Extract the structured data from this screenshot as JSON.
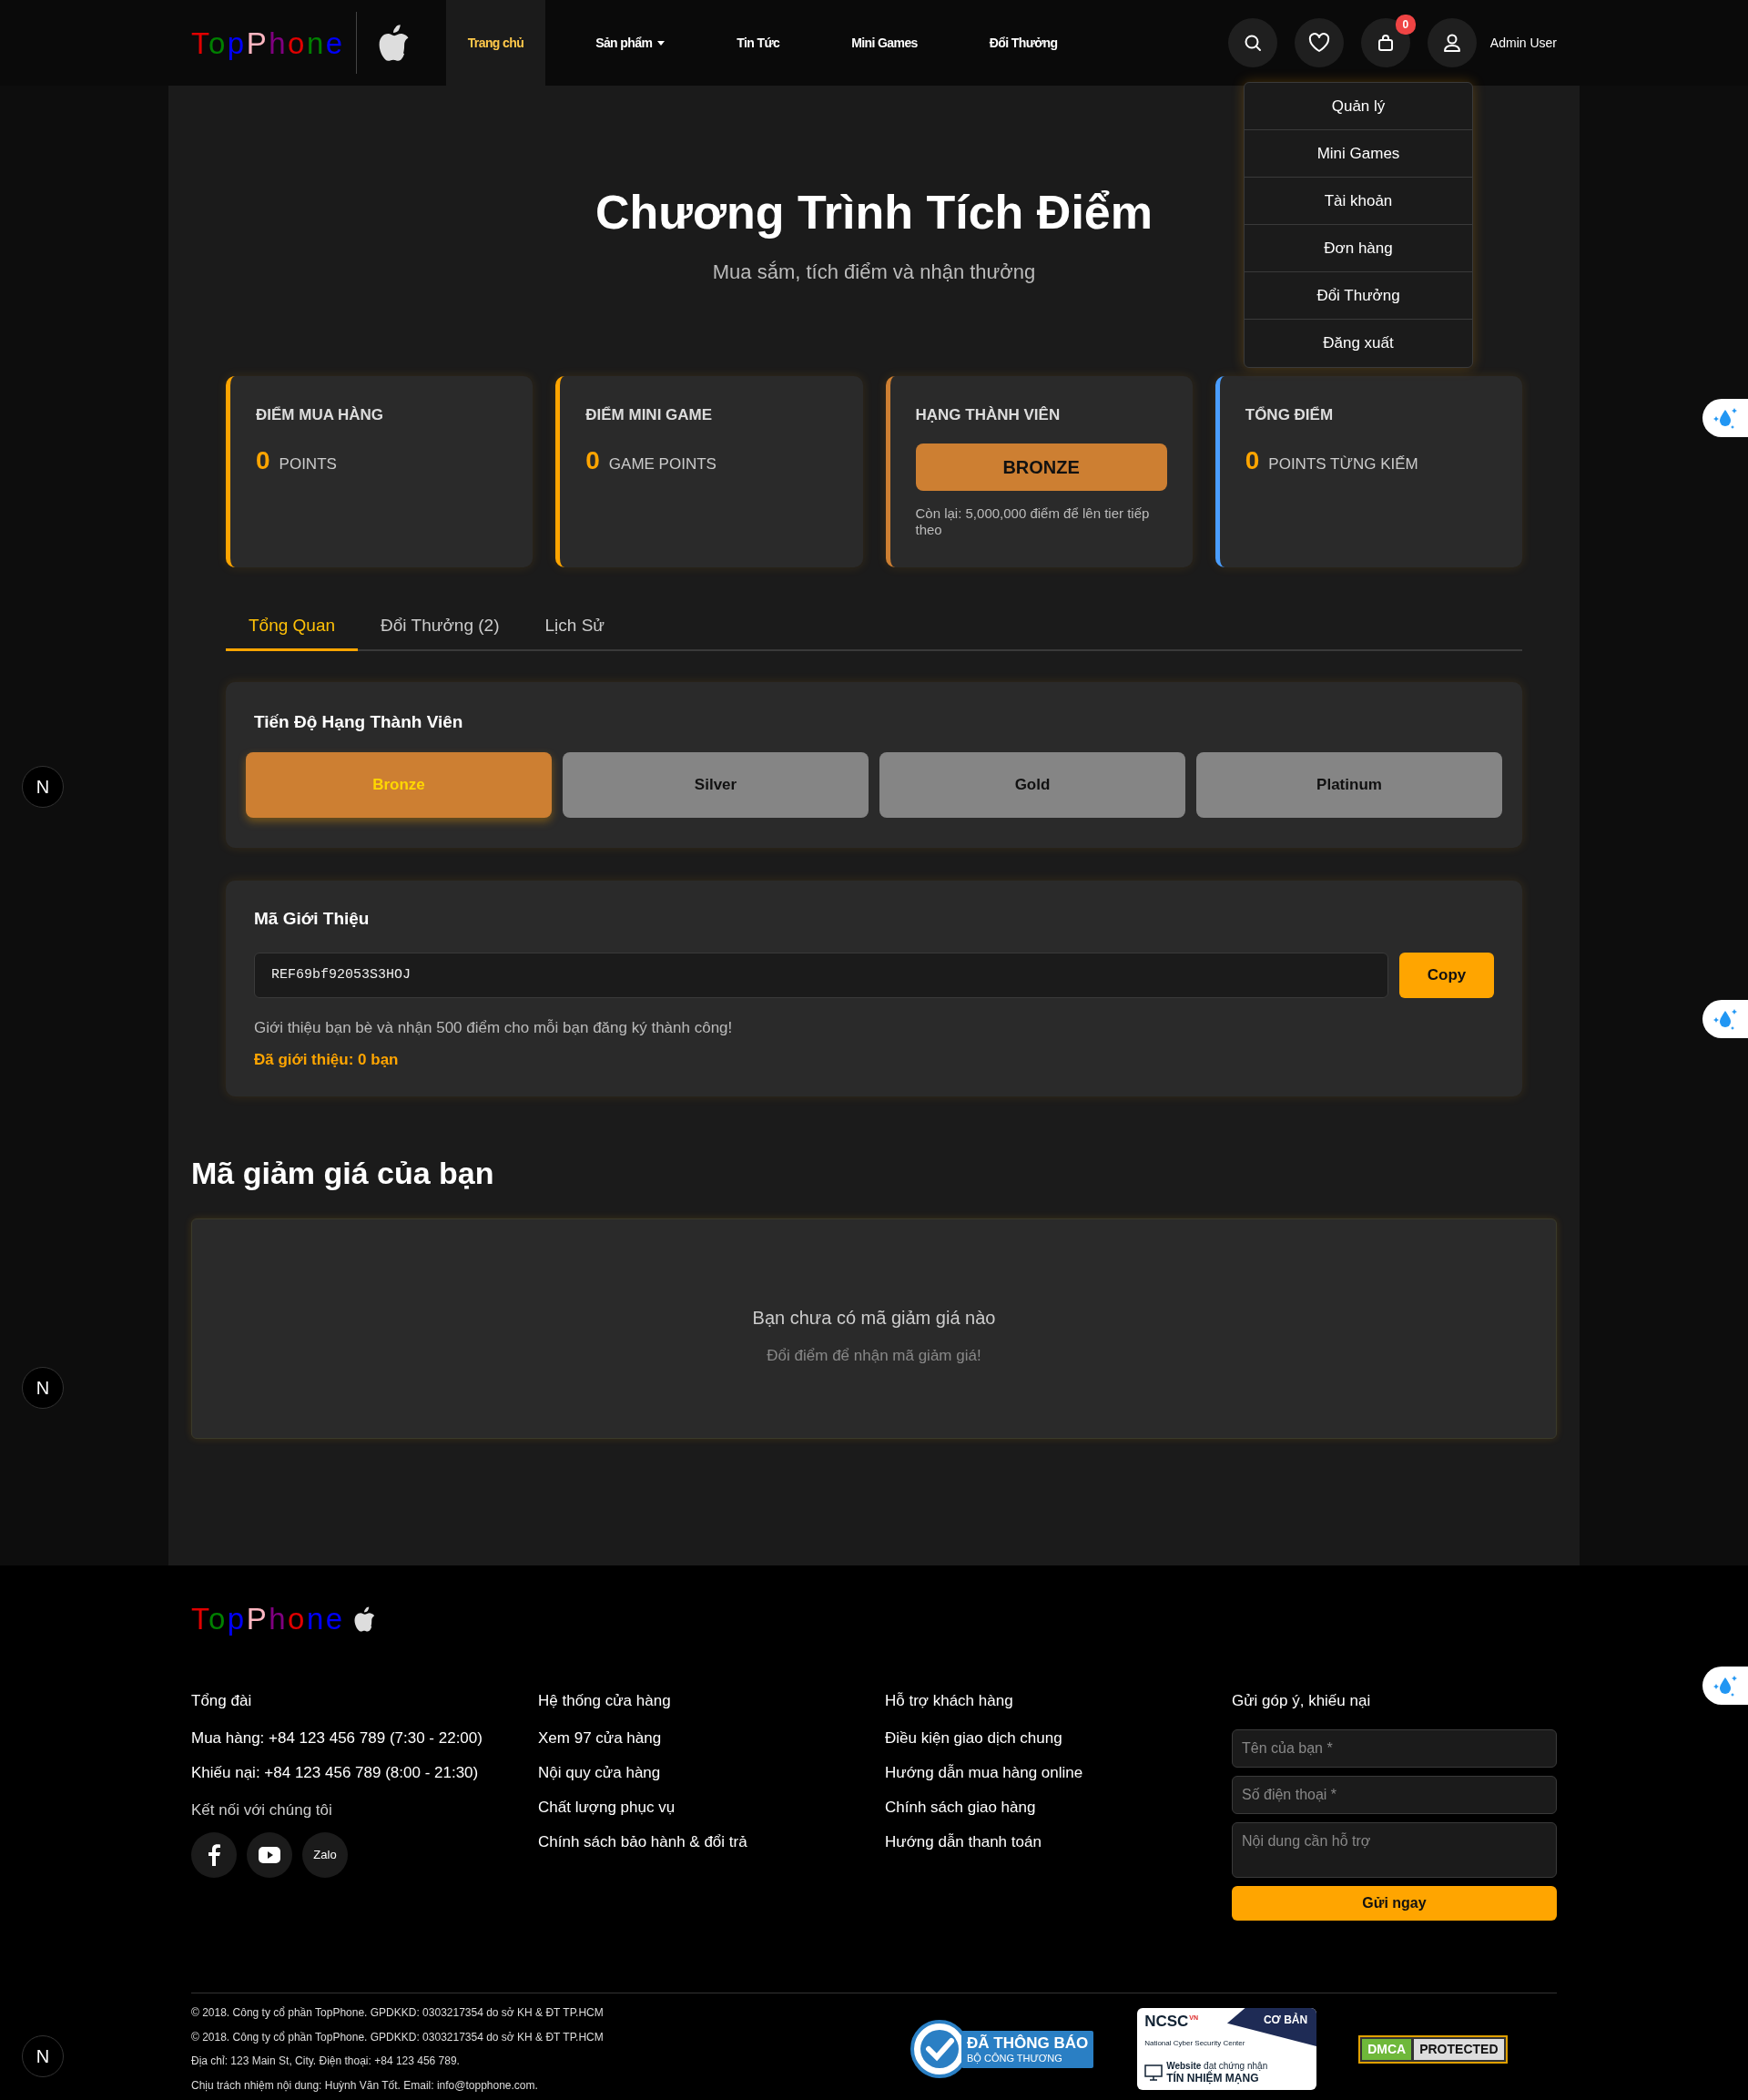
{
  "logo": {
    "letters": [
      {
        "text": "T",
        "color": "#e00000"
      },
      {
        "text": "o",
        "color": "#008000"
      },
      {
        "text": "p",
        "color": "#0000ff"
      },
      {
        "text": "P",
        "color": "#ffb6c1"
      },
      {
        "text": "h",
        "color": "#800080"
      },
      {
        "text": "o",
        "color": "#e00000"
      },
      {
        "text": "n",
        "color": "#008000"
      },
      {
        "text": "e",
        "color": "#0000ff"
      }
    ]
  },
  "nav": [
    {
      "label": "Trang chủ",
      "selected": true,
      "kind": "link"
    },
    {
      "label": "Sản phẩm",
      "selected": false,
      "kind": "dropdown"
    },
    {
      "label": "Tin Tức",
      "selected": false,
      "kind": "link"
    },
    {
      "label": "Mini Games",
      "selected": false,
      "kind": "link"
    },
    {
      "label": "Đổi Thưởng",
      "selected": false,
      "kind": "link"
    }
  ],
  "header_actions": {
    "cart_count": "0",
    "user_name": "Admin User"
  },
  "user_menu": [
    "Quản lý",
    "Mini Games",
    "Tài khoản",
    "Đơn hàng",
    "Đổi Thưởng",
    "Đăng xuất"
  ],
  "hero": {
    "title": "Chương Trình Tích Điểm",
    "subtitle": "Mua sắm, tích điểm và nhận thưởng"
  },
  "stat_cards": [
    {
      "kind": "points",
      "title": "ĐIỂM MUA HÀNG",
      "value": "0",
      "unit": "POINTS",
      "color": "#ffa500"
    },
    {
      "kind": "points",
      "title": "ĐIỂM MINI GAME",
      "value": "0",
      "unit": "GAME POINTS",
      "color": "#ffa500"
    },
    {
      "kind": "tier",
      "title": "HẠNG THÀNH VIÊN",
      "tier": "BRONZE",
      "note": "Còn lại: 5,000,000 điểm để lên tier tiếp theo",
      "color": "#cd7f32"
    },
    {
      "kind": "points",
      "title": "TỔNG ĐIỂM",
      "value": "0",
      "unit": "POINTS TỪNG KIẾM",
      "color": "#4a9eff"
    }
  ],
  "tabs": [
    {
      "label": "Tổng Quan",
      "selected": true
    },
    {
      "label": "Đổi Thưởng (2)",
      "selected": false
    },
    {
      "label": "Lịch Sử",
      "selected": false
    }
  ],
  "tier_progress": {
    "title": "Tiến Độ Hạng Thành Viên",
    "tiers": [
      {
        "label": "Bronze",
        "selected": true
      },
      {
        "label": "Silver",
        "selected": false
      },
      {
        "label": "Gold",
        "selected": false
      },
      {
        "label": "Platinum",
        "selected": false
      }
    ]
  },
  "referral": {
    "title": "Mã Giới Thiệu",
    "code": "REF69bf92053S3HOJ",
    "button": "Copy",
    "note": "Giới thiệu bạn bè và nhận 500 điểm cho mỗi bạn đăng ký thành công!",
    "count_text": "Đã giới thiệu: 0 bạn"
  },
  "coupons": {
    "title": "Mã giảm giá của bạn",
    "empty_title": "Bạn chưa có mã giảm giá nào",
    "empty_hint": "Đổi điểm để nhận mã giảm giá!"
  },
  "footer": {
    "logo": {
      "letters": [
        {
          "text": "T",
          "color": "#e00000"
        },
        {
          "text": "o",
          "color": "#008000"
        },
        {
          "text": "p",
          "color": "#0000ff"
        },
        {
          "text": "P",
          "color": "#ffb6c1"
        },
        {
          "text": "h",
          "color": "#800080"
        },
        {
          "text": "o",
          "color": "#e00000"
        },
        {
          "text": "n",
          "color": "#0000ff"
        },
        {
          "text": "e",
          "color": "#0000ff"
        }
      ]
    },
    "columns": [
      {
        "title": "Tổng đài",
        "items": [
          "Mua hàng: +84 123 456 789 (7:30 - 22:00)",
          "Khiếu nại: +84 123 456 789 (8:00 - 21:30)"
        ],
        "connect_label": "Kết nối với chúng tôi"
      },
      {
        "title": "Hệ thống cửa hàng",
        "items": [
          "Xem 97 cửa hàng",
          "Nội quy cửa hàng",
          "Chất lượng phục vụ",
          "Chính sách bảo hành & đổi trả"
        ]
      },
      {
        "title": "Hỗ trợ khách hàng",
        "items": [
          "Điều kiện giao dịch chung",
          "Hướng dẫn mua hàng online",
          "Chính sách giao hàng",
          "Hướng dẫn thanh toán"
        ]
      }
    ],
    "social": [
      {
        "kind": "facebook"
      },
      {
        "kind": "youtube"
      },
      {
        "kind": "zalo",
        "label": "Zalo"
      }
    ],
    "form": {
      "title": "Gửi góp ý, khiếu nại",
      "fields": [
        {
          "kind": "input",
          "placeholder": "Tên của bạn *"
        },
        {
          "kind": "input",
          "placeholder": "Số điện thoại *"
        },
        {
          "kind": "textarea",
          "placeholder": "Nội dung cần hỗ trợ"
        }
      ],
      "button": "Gửi ngay"
    },
    "copyright": [
      "© 2018. Công ty cổ phần TopPhone. GPDKKD: 0303217354 do sở KH & ĐT TP.HCM",
      "© 2018. Công ty cổ phần TopPhone. GPDKKD: 0303217354 do sở KH & ĐT TP.HCM",
      "Địa chỉ: 123 Main St, City. Điện thoại: +84 123 456 789.",
      "Chịu trách nhiệm nội dung: Huỳnh Văn Tốt. Email: info@topphone.com."
    ],
    "badges": [
      {
        "kind": "moit",
        "lines": [
          "ĐÃ THÔNG BÁO",
          "BỘ CÔNG THƯƠNG"
        ]
      },
      {
        "kind": "ncsc",
        "lines": [
          "NCSC",
          "VN",
          "National Cyber Security Center",
          "CƠ BẢN",
          "**Website** đạt chứng nhận",
          "TÍN NHIỆM MẠNG"
        ]
      },
      {
        "kind": "dmca",
        "lines": [
          "DMCA",
          "PROTECTED"
        ]
      }
    ]
  },
  "floating_widgets": [
    {
      "kind": "drop"
    },
    {
      "kind": "drop"
    },
    {
      "kind": "drop"
    },
    {
      "kind": "dev",
      "text": "N"
    },
    {
      "kind": "dev",
      "text": "N"
    },
    {
      "kind": "dev",
      "text": "N"
    }
  ]
}
